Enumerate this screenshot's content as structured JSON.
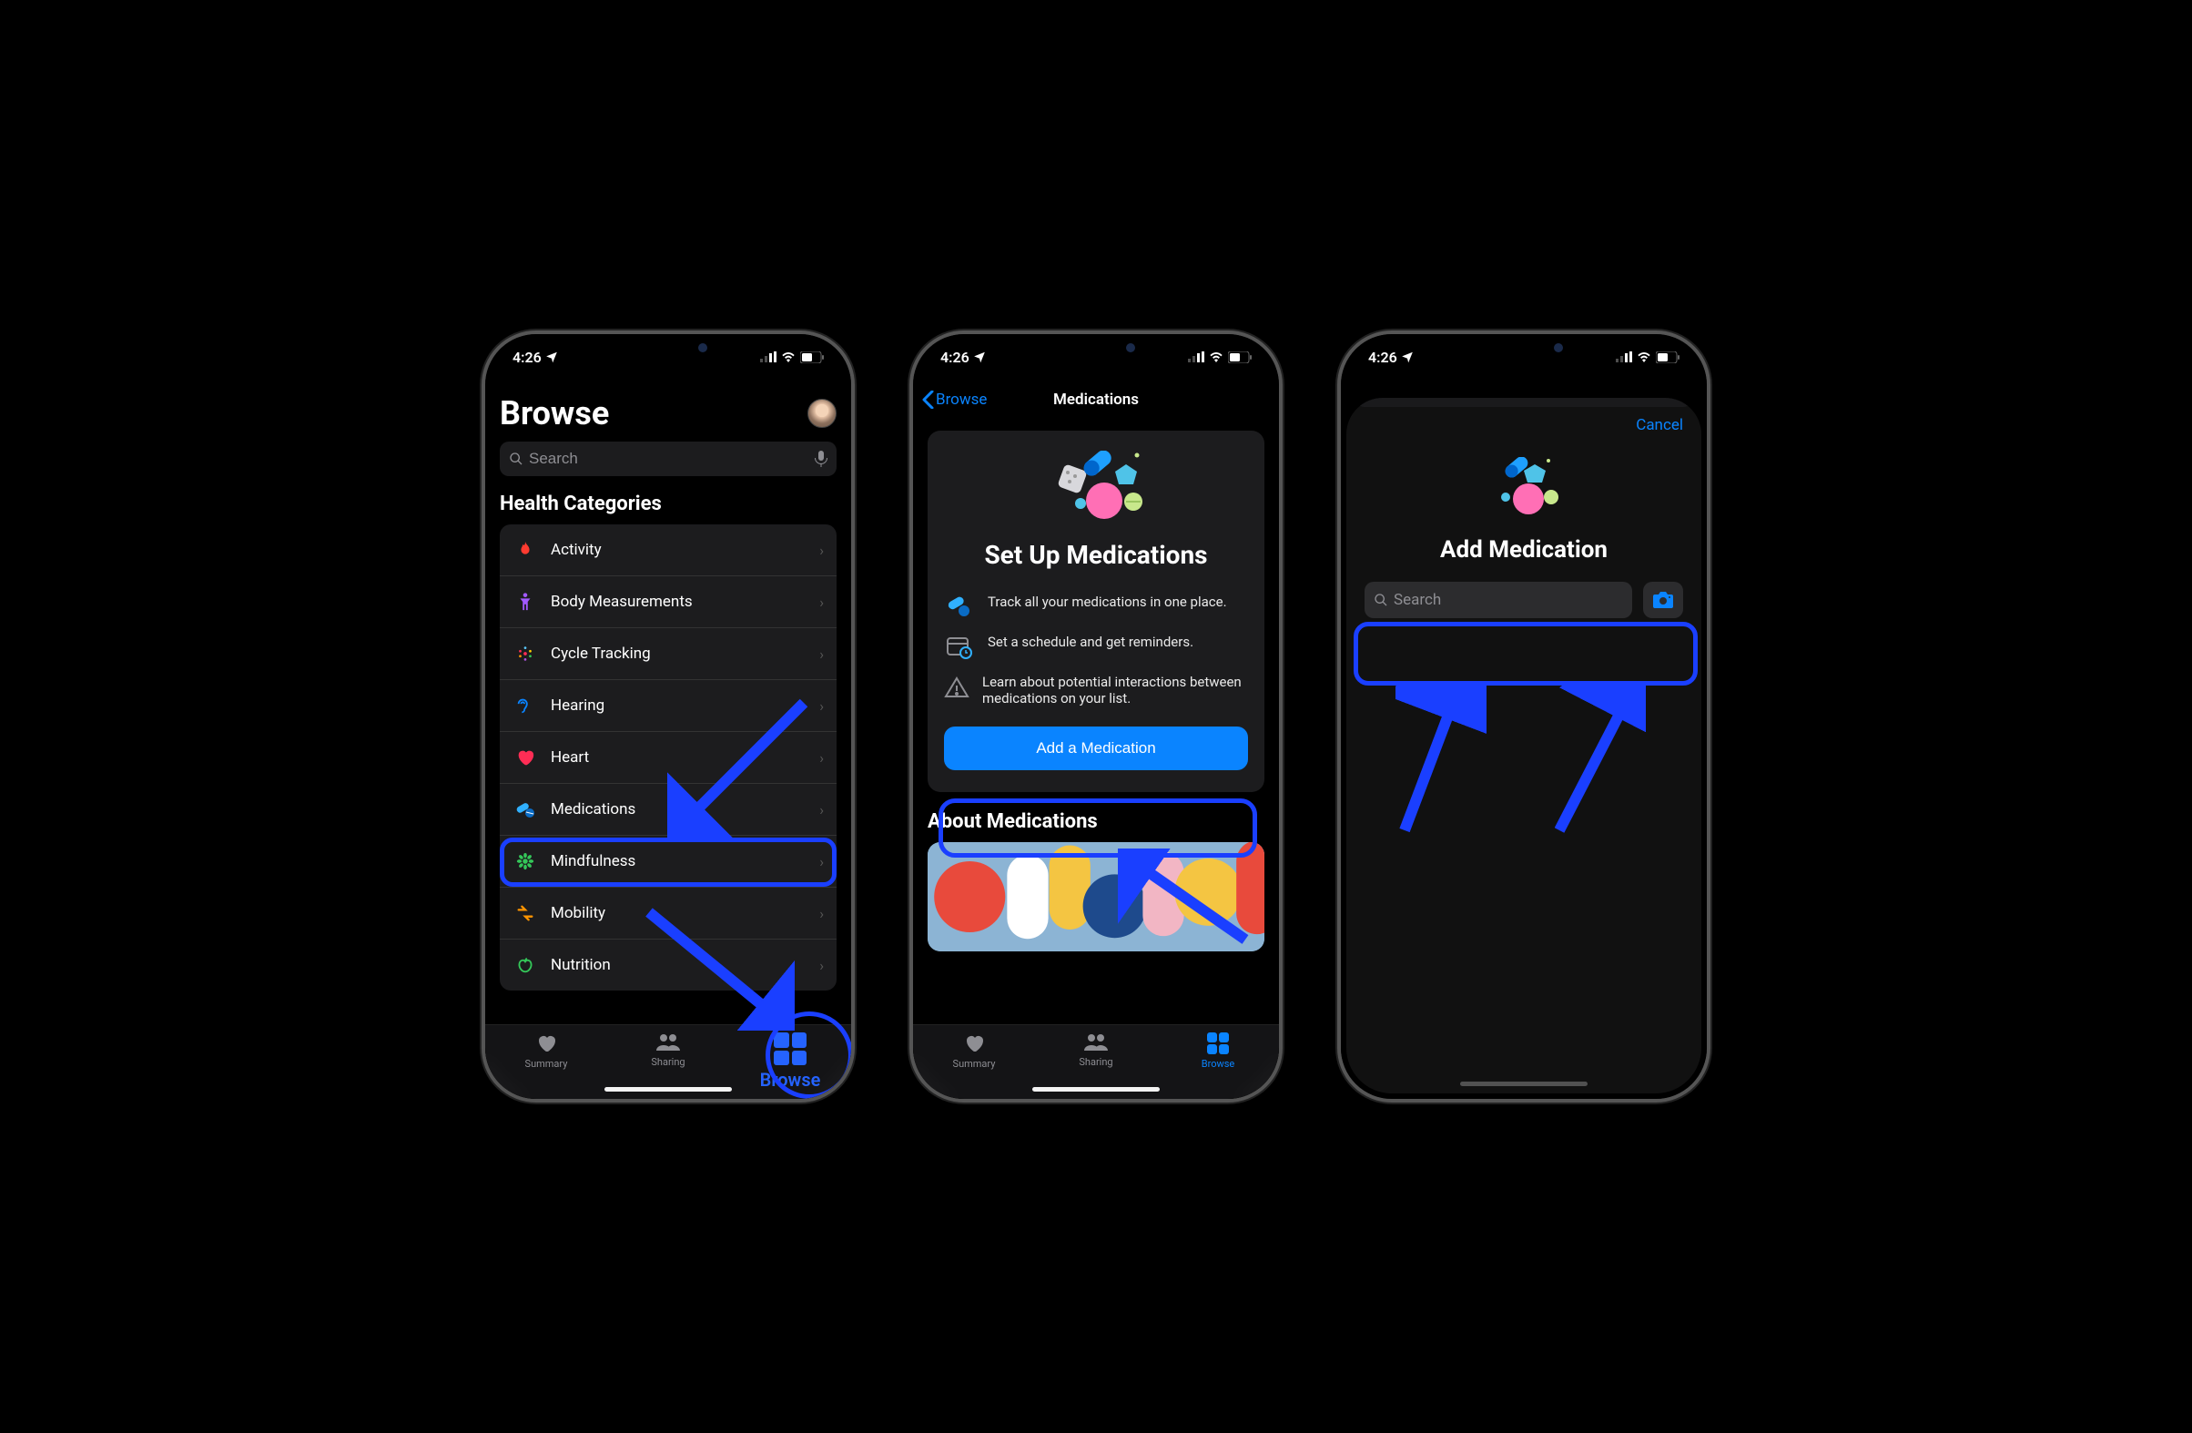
{
  "status_time": "4:26",
  "phone1": {
    "title": "Browse",
    "search_placeholder": "Search",
    "section": "Health Categories",
    "items": [
      {
        "id": "activity",
        "label": "Activity",
        "color": "#ff3b30"
      },
      {
        "id": "body",
        "label": "Body Measurements",
        "color": "#a259ff"
      },
      {
        "id": "cycle",
        "label": "Cycle Tracking",
        "color": "#ff2d55"
      },
      {
        "id": "hearing",
        "label": "Hearing",
        "color": "#0a84ff"
      },
      {
        "id": "heart",
        "label": "Heart",
        "color": "#ff2d55"
      },
      {
        "id": "medications",
        "label": "Medications",
        "color": "#30b0ff"
      },
      {
        "id": "mindfulness",
        "label": "Mindfulness",
        "color": "#34c759"
      },
      {
        "id": "mobility",
        "label": "Mobility",
        "color": "#ff9500"
      },
      {
        "id": "nutrition",
        "label": "Nutrition",
        "color": "#34c759"
      }
    ],
    "tabs": {
      "summary": "Summary",
      "sharing": "Sharing",
      "browse": "Browse"
    }
  },
  "phone2": {
    "back": "Browse",
    "title": "Medications",
    "card_title": "Set Up Medications",
    "features": [
      "Track all your medications in one place.",
      "Set a schedule and get reminders.",
      "Learn about potential interactions between medications on your list."
    ],
    "button": "Add a Medication",
    "about": "About Medications",
    "tabs": {
      "summary": "Summary",
      "sharing": "Sharing",
      "browse": "Browse"
    }
  },
  "phone3": {
    "cancel": "Cancel",
    "title": "Add Medication",
    "search_placeholder": "Search"
  },
  "colors": {
    "highlight": "#1a3fff",
    "ios_blue": "#0a84ff"
  }
}
